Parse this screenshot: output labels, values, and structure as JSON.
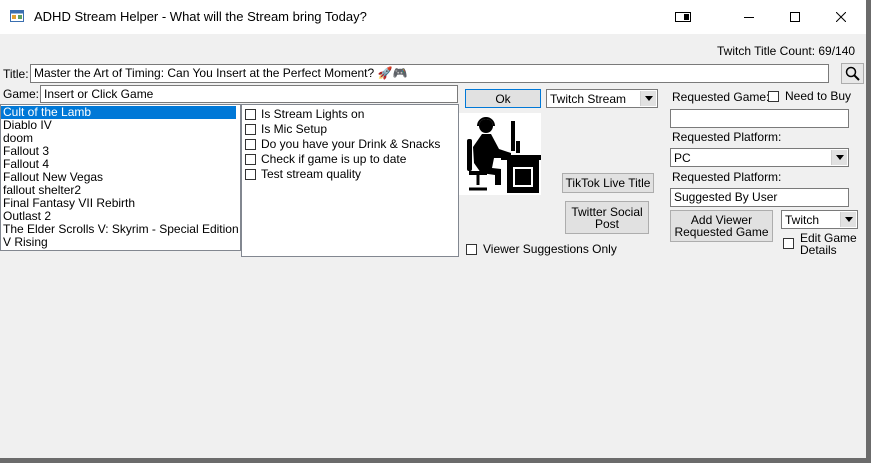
{
  "window": {
    "title": "ADHD Stream Helper - What will the Stream bring Today?"
  },
  "header": {
    "title_count": "Twitch Title Count: 69/140"
  },
  "title_row": {
    "label": "Title:",
    "value": "Master the Art of Timing: Can You Insert at the Perfect Moment? 🚀🎮"
  },
  "game_row": {
    "label": "Game:",
    "value": "Insert or Click Game",
    "ok_label": "Ok",
    "platform_select": "Twitch Stream"
  },
  "games": [
    "Cult of the Lamb",
    "Diablo IV",
    "doom",
    "Fallout 3",
    "Fallout 4",
    "Fallout New Vegas",
    "fallout shelter2",
    "Final Fantasy VII Rebirth",
    "Outlast 2",
    "The Elder Scrolls V: Skyrim - Special Edition",
    "V Rising"
  ],
  "checklist": [
    "Is Stream Lights on",
    "Is Mic Setup",
    "Do you have your Drink & Snacks",
    "Check if game is up to date",
    "Test stream quality"
  ],
  "actions": {
    "tiktok": "TikTok Live Title",
    "twitter_l1": "Twitter Social",
    "twitter_l2": "Post",
    "viewer_only": "Viewer Suggestions Only"
  },
  "request": {
    "game_label": "Requested Game:",
    "need_to_buy": "Need to Buy",
    "platform_label": "Requested Platform:",
    "platform_value": "PC",
    "platform_label2": "Requested Platform:",
    "suggested_by": "Suggested By User",
    "add_l1": "Add Viewer",
    "add_l2": "Requested Game",
    "service_value": "Twitch",
    "edit_l1": "Edit Game",
    "edit_l2": "Details"
  },
  "icons": {
    "app": "app-window-icon",
    "search": "magnifier-icon",
    "streamer": "streamer-desk-icon"
  }
}
